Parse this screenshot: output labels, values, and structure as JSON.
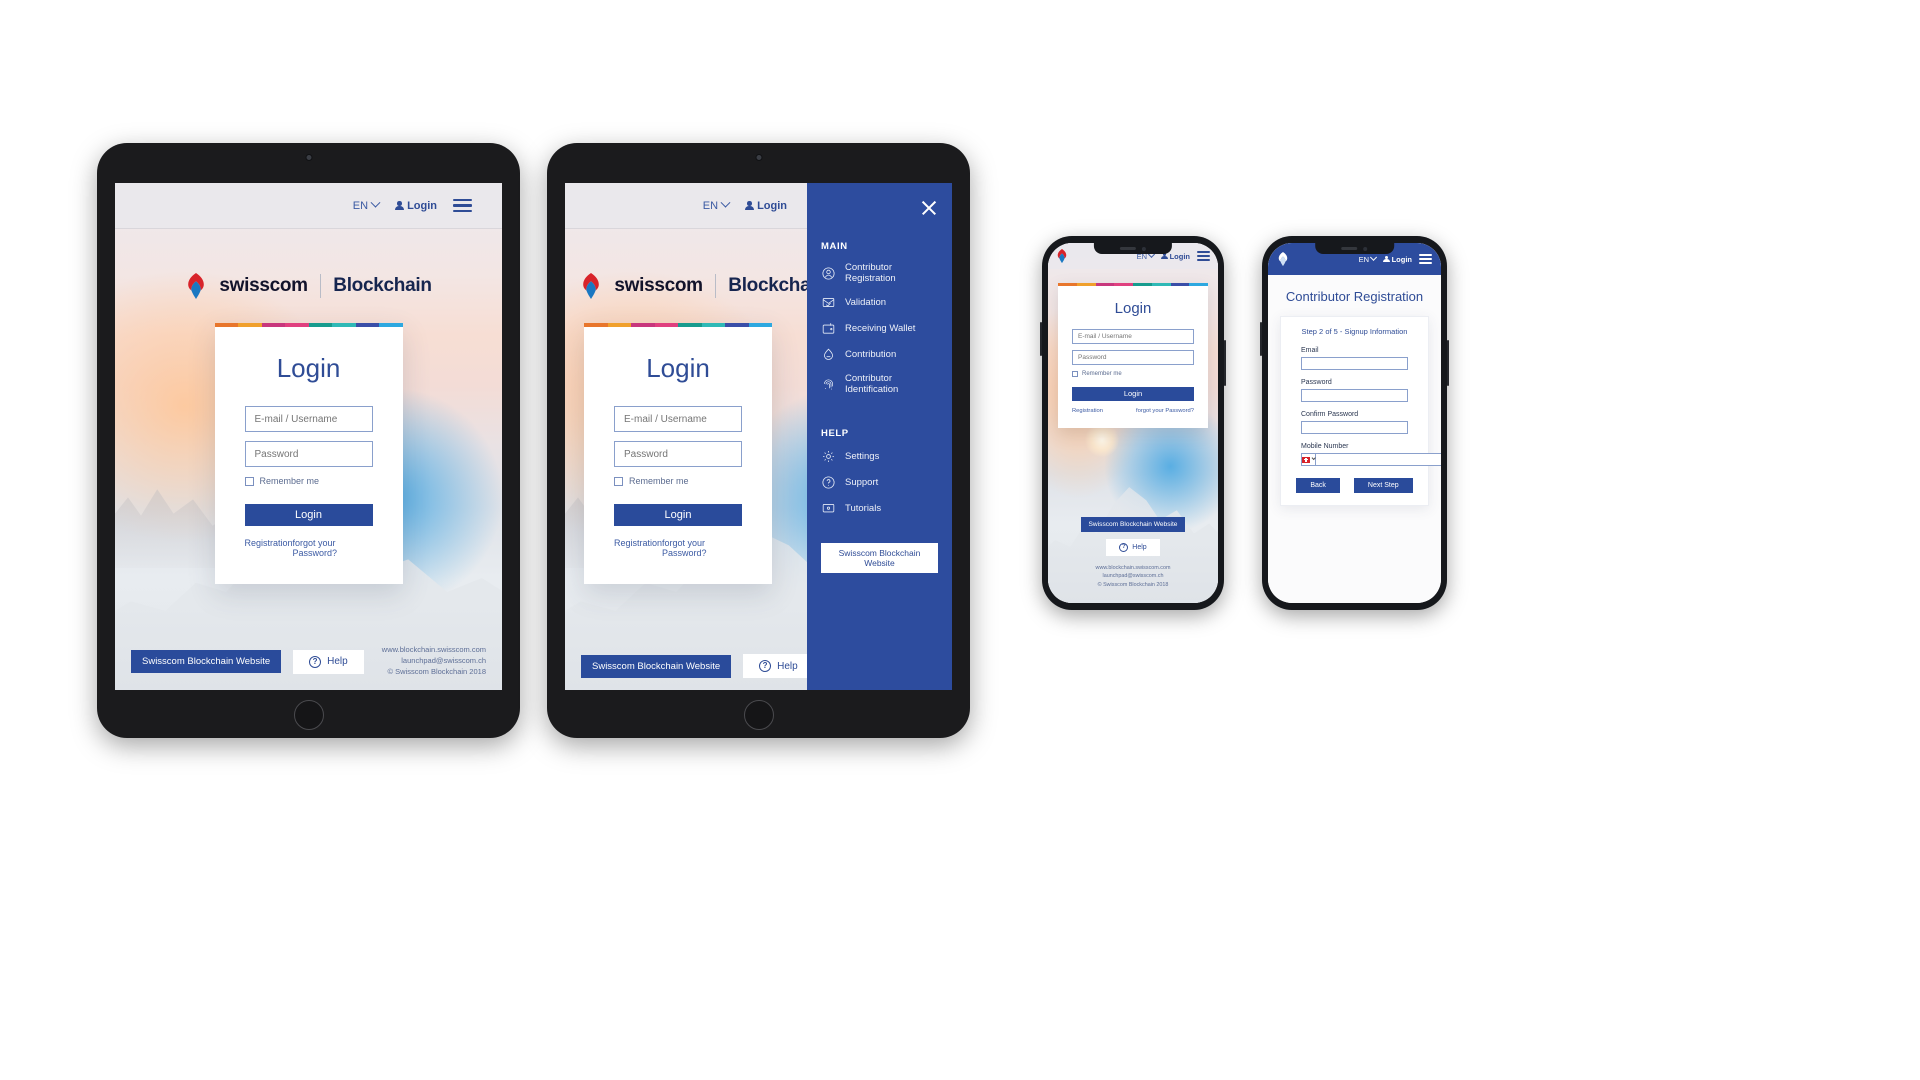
{
  "header": {
    "lang": "EN",
    "login": "Login",
    "lang_icon": "chevron-down-icon",
    "login_icon": "person-icon",
    "menu_icon": "hamburger-menu-icon"
  },
  "brand": {
    "name": "swisscom",
    "product": "Blockchain",
    "logo_icon": "swisscom-lifeform-logo"
  },
  "login_card": {
    "title": "Login",
    "email_placeholder": "E-mail / Username",
    "password_placeholder": "Password",
    "remember_label": "Remember me",
    "submit_label": "Login",
    "registration_link": "Registration",
    "forgot_link": "forgot your Password?",
    "stripe_colors": [
      "#e8762c",
      "#f0a02c",
      "#c8377d",
      "#e0407f",
      "#179c8e",
      "#2fb9b6",
      "#3a4ea8",
      "#2da8e0"
    ]
  },
  "footer": {
    "website_button": "Swisscom Blockchain Website",
    "help_button": "Help",
    "help_icon": "question-circle-icon",
    "meta_lines": [
      "www.blockchain.swisscom.com",
      "launchpad@swisscom.ch",
      "© Swisscom Blockchain 2018"
    ]
  },
  "drawer": {
    "close_icon": "close-x-icon",
    "sections": [
      {
        "heading": "MAIN",
        "items": [
          {
            "label": "Contributor Registration",
            "icon": "user-circle-icon"
          },
          {
            "label": "Validation",
            "icon": "envelope-check-icon"
          },
          {
            "label": "Receiving Wallet",
            "icon": "wallet-icon"
          },
          {
            "label": "Contribution",
            "icon": "coin-drop-icon"
          },
          {
            "label": "Contributor Identification",
            "icon": "fingerprint-icon"
          }
        ]
      },
      {
        "heading": "HELP",
        "items": [
          {
            "label": "Settings",
            "icon": "gear-icon"
          },
          {
            "label": "Support",
            "icon": "question-circle-icon"
          },
          {
            "label": "Tutorials",
            "icon": "presentation-screen-icon"
          }
        ]
      }
    ],
    "website_button": "Swisscom Blockchain Website"
  },
  "registration": {
    "page_title": "Contributor Registration",
    "step_label": "Step 2 of 5 - Signup Information",
    "fields": [
      {
        "label": "Email",
        "value": ""
      },
      {
        "label": "Password",
        "value": ""
      },
      {
        "label": "Confirm Password",
        "value": ""
      }
    ],
    "mobile_label": "Mobile Number",
    "country_flag": "swiss-flag-icon",
    "mobile_value": "",
    "back_button": "Back",
    "next_button": "Next Step"
  },
  "colors": {
    "brand_blue": "#2a4b9b",
    "drawer_blue": "#2d4c9e",
    "link_blue": "#3b5aa3",
    "flag_red": "#d8232a"
  }
}
